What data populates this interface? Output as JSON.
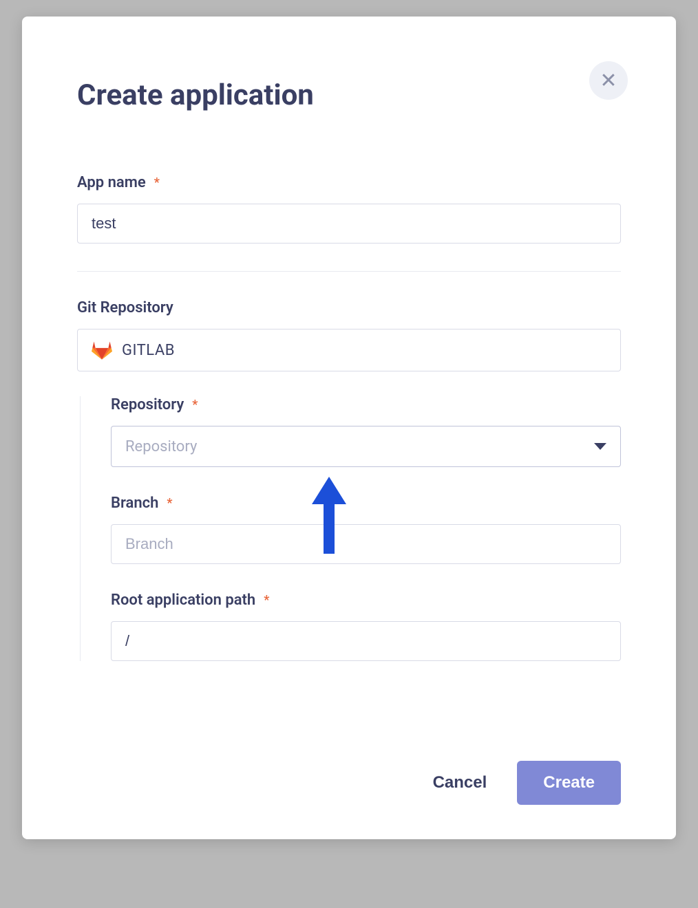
{
  "modal": {
    "title": "Create application",
    "close_label": "✕"
  },
  "fields": {
    "app_name": {
      "label": "App name",
      "value": "test",
      "required": "*"
    },
    "git_repo": {
      "label": "Git Repository"
    },
    "provider": {
      "name": "GITLAB",
      "icon": "gitlab-icon"
    },
    "repository": {
      "label": "Repository",
      "placeholder": "Repository",
      "required": "*"
    },
    "branch": {
      "label": "Branch",
      "placeholder": "Branch",
      "required": "*"
    },
    "root_path": {
      "label": "Root application path",
      "value": "/",
      "required": "*"
    }
  },
  "footer": {
    "cancel": "Cancel",
    "create": "Create"
  },
  "colors": {
    "primary": "#8089d6",
    "text": "#3a3f63",
    "required": "#e8663b"
  }
}
